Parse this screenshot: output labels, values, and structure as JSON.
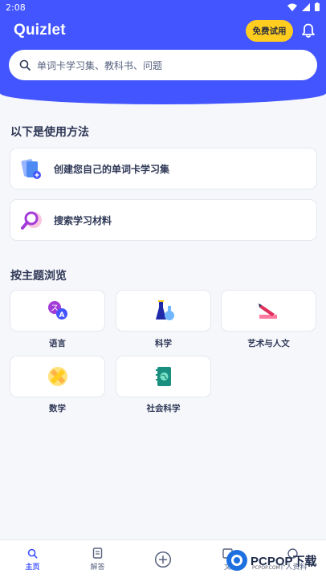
{
  "status": {
    "time": "2:08"
  },
  "header": {
    "logo": "Quizlet",
    "trial_button": "免费试用"
  },
  "search": {
    "placeholder": "单词卡学习集、教科书、问题"
  },
  "howto": {
    "title": "以下是使用方法",
    "items": [
      {
        "label": "创建您自己的单词卡学习集",
        "icon": "create-cards-icon"
      },
      {
        "label": "搜索学习材料",
        "icon": "search-material-icon"
      }
    ]
  },
  "browse": {
    "title": "按主题浏览",
    "subjects": [
      {
        "label": "语言",
        "icon": "language-icon"
      },
      {
        "label": "科学",
        "icon": "science-icon"
      },
      {
        "label": "艺术与人文",
        "icon": "arts-icon"
      },
      {
        "label": "数学",
        "icon": "math-icon"
      },
      {
        "label": "社会科学",
        "icon": "social-science-icon"
      }
    ]
  },
  "nav": {
    "items": [
      {
        "label": "主页",
        "icon": "home-search-icon",
        "active": true
      },
      {
        "label": "解答",
        "icon": "book-icon",
        "active": false
      },
      {
        "label": "",
        "icon": "add-icon",
        "active": false
      },
      {
        "label": "文",
        "icon": "folder-icon",
        "active": false
      },
      {
        "label": "个人资料",
        "icon": "profile-icon",
        "active": false
      }
    ]
  },
  "watermark": {
    "text": "PCPOP下载",
    "sub": "PCPOP.COM"
  },
  "colors": {
    "primary": "#4255ff",
    "accent_yellow": "#ffcd1f",
    "text": "#2e3856",
    "background": "#f6f7fb"
  }
}
